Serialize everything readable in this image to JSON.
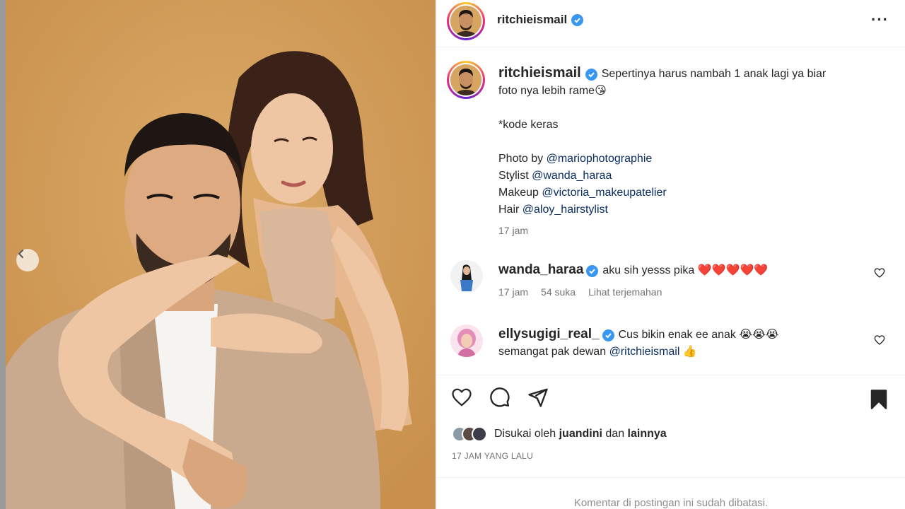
{
  "post": {
    "username": "ritchieismail",
    "verified": true
  },
  "caption": {
    "username": "ritchieismail",
    "line1": "Sepertinya harus nambah 1 anak lagi ya biar",
    "line2": "foto nya lebih rame",
    "line2_emoji": "😘",
    "line3": "*kode keras",
    "credit_photo_label": "Photo by",
    "credit_photo": "@mariophotographie",
    "credit_stylist_label": "Stylist",
    "credit_stylist": "@wanda_haraa",
    "credit_makeup_label": "Makeup",
    "credit_makeup": "@victoria_makeupatelier",
    "credit_hair_label": "Hair",
    "credit_hair": "@aloy_hairstylist",
    "time": "17 jam"
  },
  "comments": [
    {
      "username": "wanda_haraa",
      "text": "aku sih yesss pika",
      "emoji": "❤️❤️❤️❤️❤️",
      "time": "17 jam",
      "likes": "54 suka",
      "translate": "Lihat terjemahan"
    },
    {
      "username": "ellysugigi_real_",
      "text": "Cus bikin enak ee anak",
      "emoji": "😭😭😭",
      "line2": "semangat pak dewan",
      "mention": "@ritchieismail",
      "emoji2": "👍"
    }
  ],
  "likes": {
    "prefix": "Disukai oleh",
    "user": "juandini",
    "conj": "dan",
    "others": "lainnya"
  },
  "post_time": "17 JAM YANG LALU",
  "comments_limited": "Komentar di postingan ini sudah dibatasi.",
  "colors": {
    "background": "#d6a15d",
    "verified": "#3897f0",
    "mention": "#0a2d63",
    "heart": "#e0245e"
  },
  "icons": [
    "heart-icon",
    "comment-icon",
    "share-icon",
    "bookmark-icon",
    "more-icon",
    "chevron-left-icon",
    "verified-icon"
  ]
}
